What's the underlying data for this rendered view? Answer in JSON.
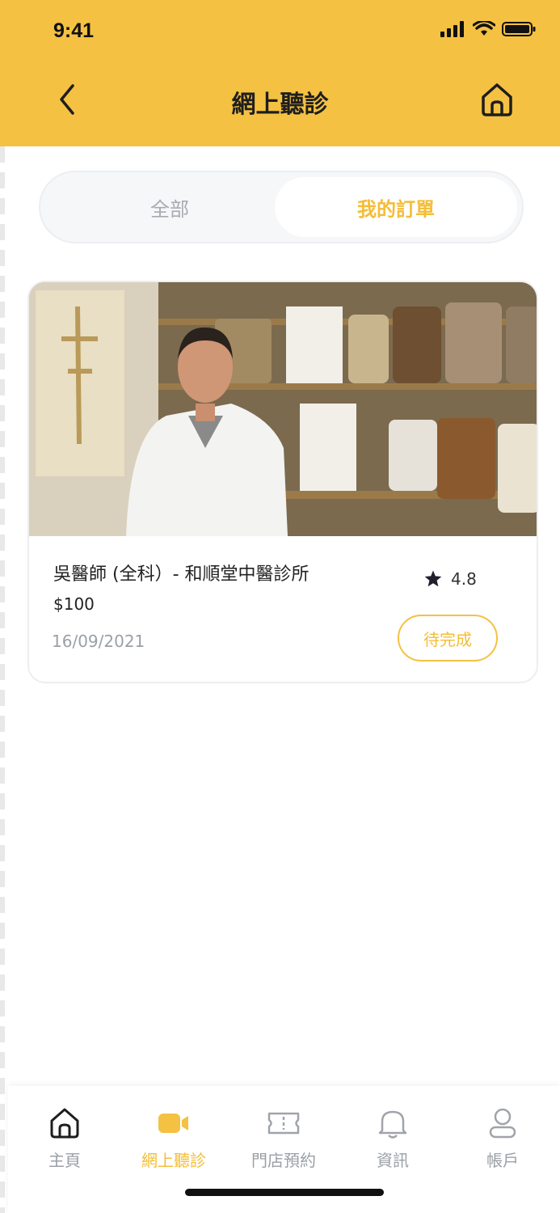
{
  "status_bar": {
    "time": "9:41"
  },
  "header": {
    "title": "網上聽診"
  },
  "tabs": [
    {
      "label": "全部",
      "active": false
    },
    {
      "label": "我的訂單",
      "active": true
    }
  ],
  "order": {
    "photo_alt": "吳醫師",
    "doctor": "吳醫師 (全科）-  和順堂中醫診所",
    "price": "$100",
    "date": "16/09/2021",
    "rating": "4.8",
    "status": "待完成"
  },
  "bottom_nav": [
    {
      "label": "主頁",
      "icon": "home-icon",
      "active": false
    },
    {
      "label": "網上聽診",
      "icon": "video-icon",
      "active": true
    },
    {
      "label": "門店預約",
      "icon": "ticket-icon",
      "active": false
    },
    {
      "label": "資訊",
      "icon": "bell-icon",
      "active": false
    },
    {
      "label": "帳戶",
      "icon": "user-icon",
      "active": false
    }
  ],
  "colors": {
    "accent": "#F4C142",
    "accent_text": "#F4BD35",
    "muted": "#9aa0a6"
  }
}
